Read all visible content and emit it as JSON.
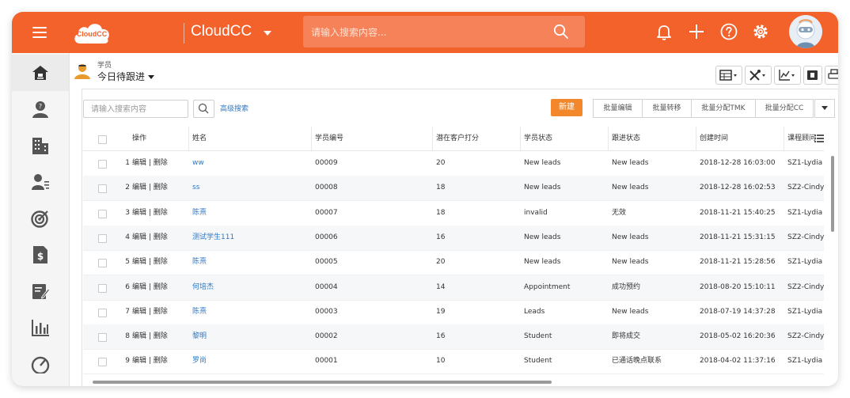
{
  "topbar": {
    "logo_text": "CloudCC",
    "app_name": "CloudCC",
    "search_placeholder": "请输入搜索内容...",
    "accent_color": "#f2622a"
  },
  "header": {
    "object_name": "学员",
    "view_name": "今日待跟进"
  },
  "list": {
    "search_placeholder": "请输入搜索内容",
    "advanced_search": "高级搜索",
    "new_button": "新建",
    "actions": [
      "批量编辑",
      "批量转移",
      "批量分配TMK",
      "批量分配CC"
    ]
  },
  "table": {
    "headers": [
      "操作",
      "姓名",
      "学员编号",
      "潜在客户打分",
      "学员状态",
      "跟进状态",
      "创建时间",
      "课程顾问"
    ],
    "edit_label": "编辑",
    "delete_label": "删除",
    "rows": [
      {
        "num": "1",
        "name": "ww",
        "id": "00009",
        "score": "20",
        "status": "New leads",
        "follow": "New leads",
        "created": "2018-12-28 16:03:00",
        "advisor": "SZ1-Lydia"
      },
      {
        "num": "2",
        "name": "ss",
        "id": "00008",
        "score": "18",
        "status": "New leads",
        "follow": "New leads",
        "created": "2018-12-28 16:02:53",
        "advisor": "SZ2-Cindy"
      },
      {
        "num": "3",
        "name": "陈熹",
        "id": "00007",
        "score": "18",
        "status": "invalid",
        "follow": "无效",
        "created": "2018-11-21 15:40:25",
        "advisor": "SZ1-Lydia"
      },
      {
        "num": "4",
        "name": "测试学生111",
        "id": "00006",
        "score": "16",
        "status": "New leads",
        "follow": "New leads",
        "created": "2018-11-21 15:31:15",
        "advisor": "SZ2-Cindy"
      },
      {
        "num": "5",
        "name": "陈熹",
        "id": "00005",
        "score": "20",
        "status": "New leads",
        "follow": "New leads",
        "created": "2018-11-21 15:28:56",
        "advisor": "SZ1-Lydia"
      },
      {
        "num": "6",
        "name": "何培杰",
        "id": "00004",
        "score": "14",
        "status": "Appointment",
        "follow": "成功预约",
        "created": "2018-08-20 15:10:11",
        "advisor": "SZ2-Cindy"
      },
      {
        "num": "7",
        "name": "陈熹",
        "id": "00003",
        "score": "19",
        "status": "Leads",
        "follow": "New leads",
        "created": "2018-07-19 14:37:28",
        "advisor": "SZ1-Lydia"
      },
      {
        "num": "8",
        "name": "黎明",
        "id": "00002",
        "score": "16",
        "status": "Student",
        "follow": "即将成交",
        "created": "2018-05-02 16:20:36",
        "advisor": "SZ2-Cindy"
      },
      {
        "num": "9",
        "name": "罗尚",
        "id": "00001",
        "score": "10",
        "status": "Student",
        "follow": "已通话晚点联系",
        "created": "2018-04-02 11:37:16",
        "advisor": "SZ1-Lydia"
      }
    ]
  }
}
